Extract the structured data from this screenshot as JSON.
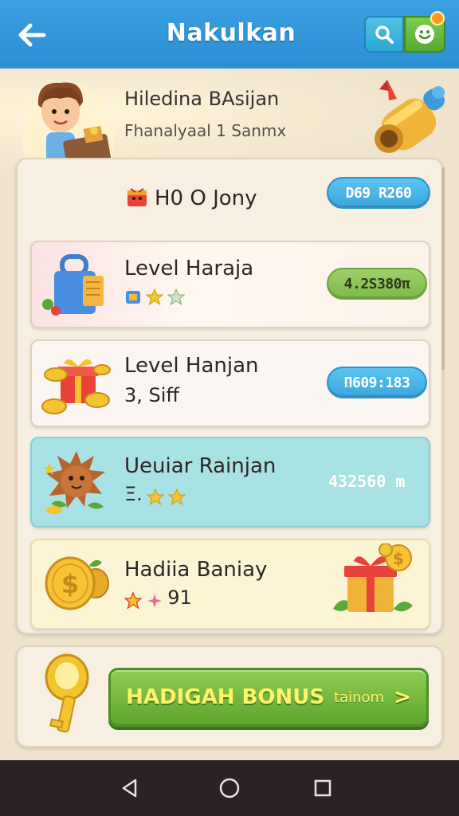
{
  "appbar": {
    "title": "Nakulkan",
    "back_icon": "arrow-left-icon",
    "search_icon": "search-icon",
    "profile_icon": "smiley-face-icon",
    "colors": {
      "bar": "#2b8fd4",
      "search": "#2ea7d4",
      "profile": "#58a932",
      "badge": "#ff9a1a"
    }
  },
  "header": {
    "title": "Hiledina BAsijan",
    "subtitle": "Fhanalyaal 1 Sanmx"
  },
  "summary": {
    "label": "H0 O Jony",
    "value": "D69 R260"
  },
  "cards": [
    {
      "title": "Level Haraja",
      "subtitle": "",
      "value": "4.2S380π",
      "stars": 2,
      "color": "#fbe3e3",
      "pill": "green"
    },
    {
      "title": "Level Hanjan",
      "subtitle": "3, Siff",
      "value": "Π609:183",
      "stars": 0,
      "color": "#fbf6f2",
      "pill": "blue"
    },
    {
      "title": "Ueuiar Rainjan",
      "subtitle": "Ξ.",
      "value": "432560 m",
      "stars": 2,
      "color": "#a9e2e4",
      "pill": "none"
    },
    {
      "title": "Hadiia Baniay",
      "subtitle": "91",
      "value": "",
      "stars": 1,
      "color": "#fbf5d6",
      "pill": "none"
    }
  ],
  "bonus": {
    "label": "HADIGAH BONUS",
    "small": "tainom",
    "arrow": ">"
  },
  "nav": {
    "back_icon": "triangle-back-icon",
    "home_icon": "circle-home-icon",
    "recents_icon": "square-recents-icon"
  }
}
